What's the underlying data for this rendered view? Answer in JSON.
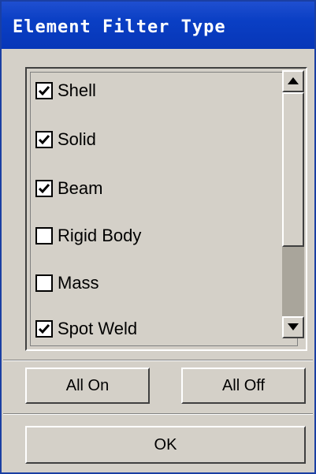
{
  "window": {
    "title": "Element Filter Type"
  },
  "filter_list": {
    "items": [
      {
        "label": "Shell",
        "checked": true
      },
      {
        "label": "Solid",
        "checked": true
      },
      {
        "label": "Beam",
        "checked": true
      },
      {
        "label": "Rigid Body",
        "checked": false
      },
      {
        "label": "Mass",
        "checked": false
      },
      {
        "label": "Spot Weld",
        "checked": true
      }
    ]
  },
  "buttons": {
    "all_on": "All On",
    "all_off": "All Off",
    "ok": "OK"
  },
  "icons": {
    "scroll_up": "triangle-up-icon",
    "scroll_down": "triangle-down-icon",
    "checkmark": "checkmark-icon"
  }
}
